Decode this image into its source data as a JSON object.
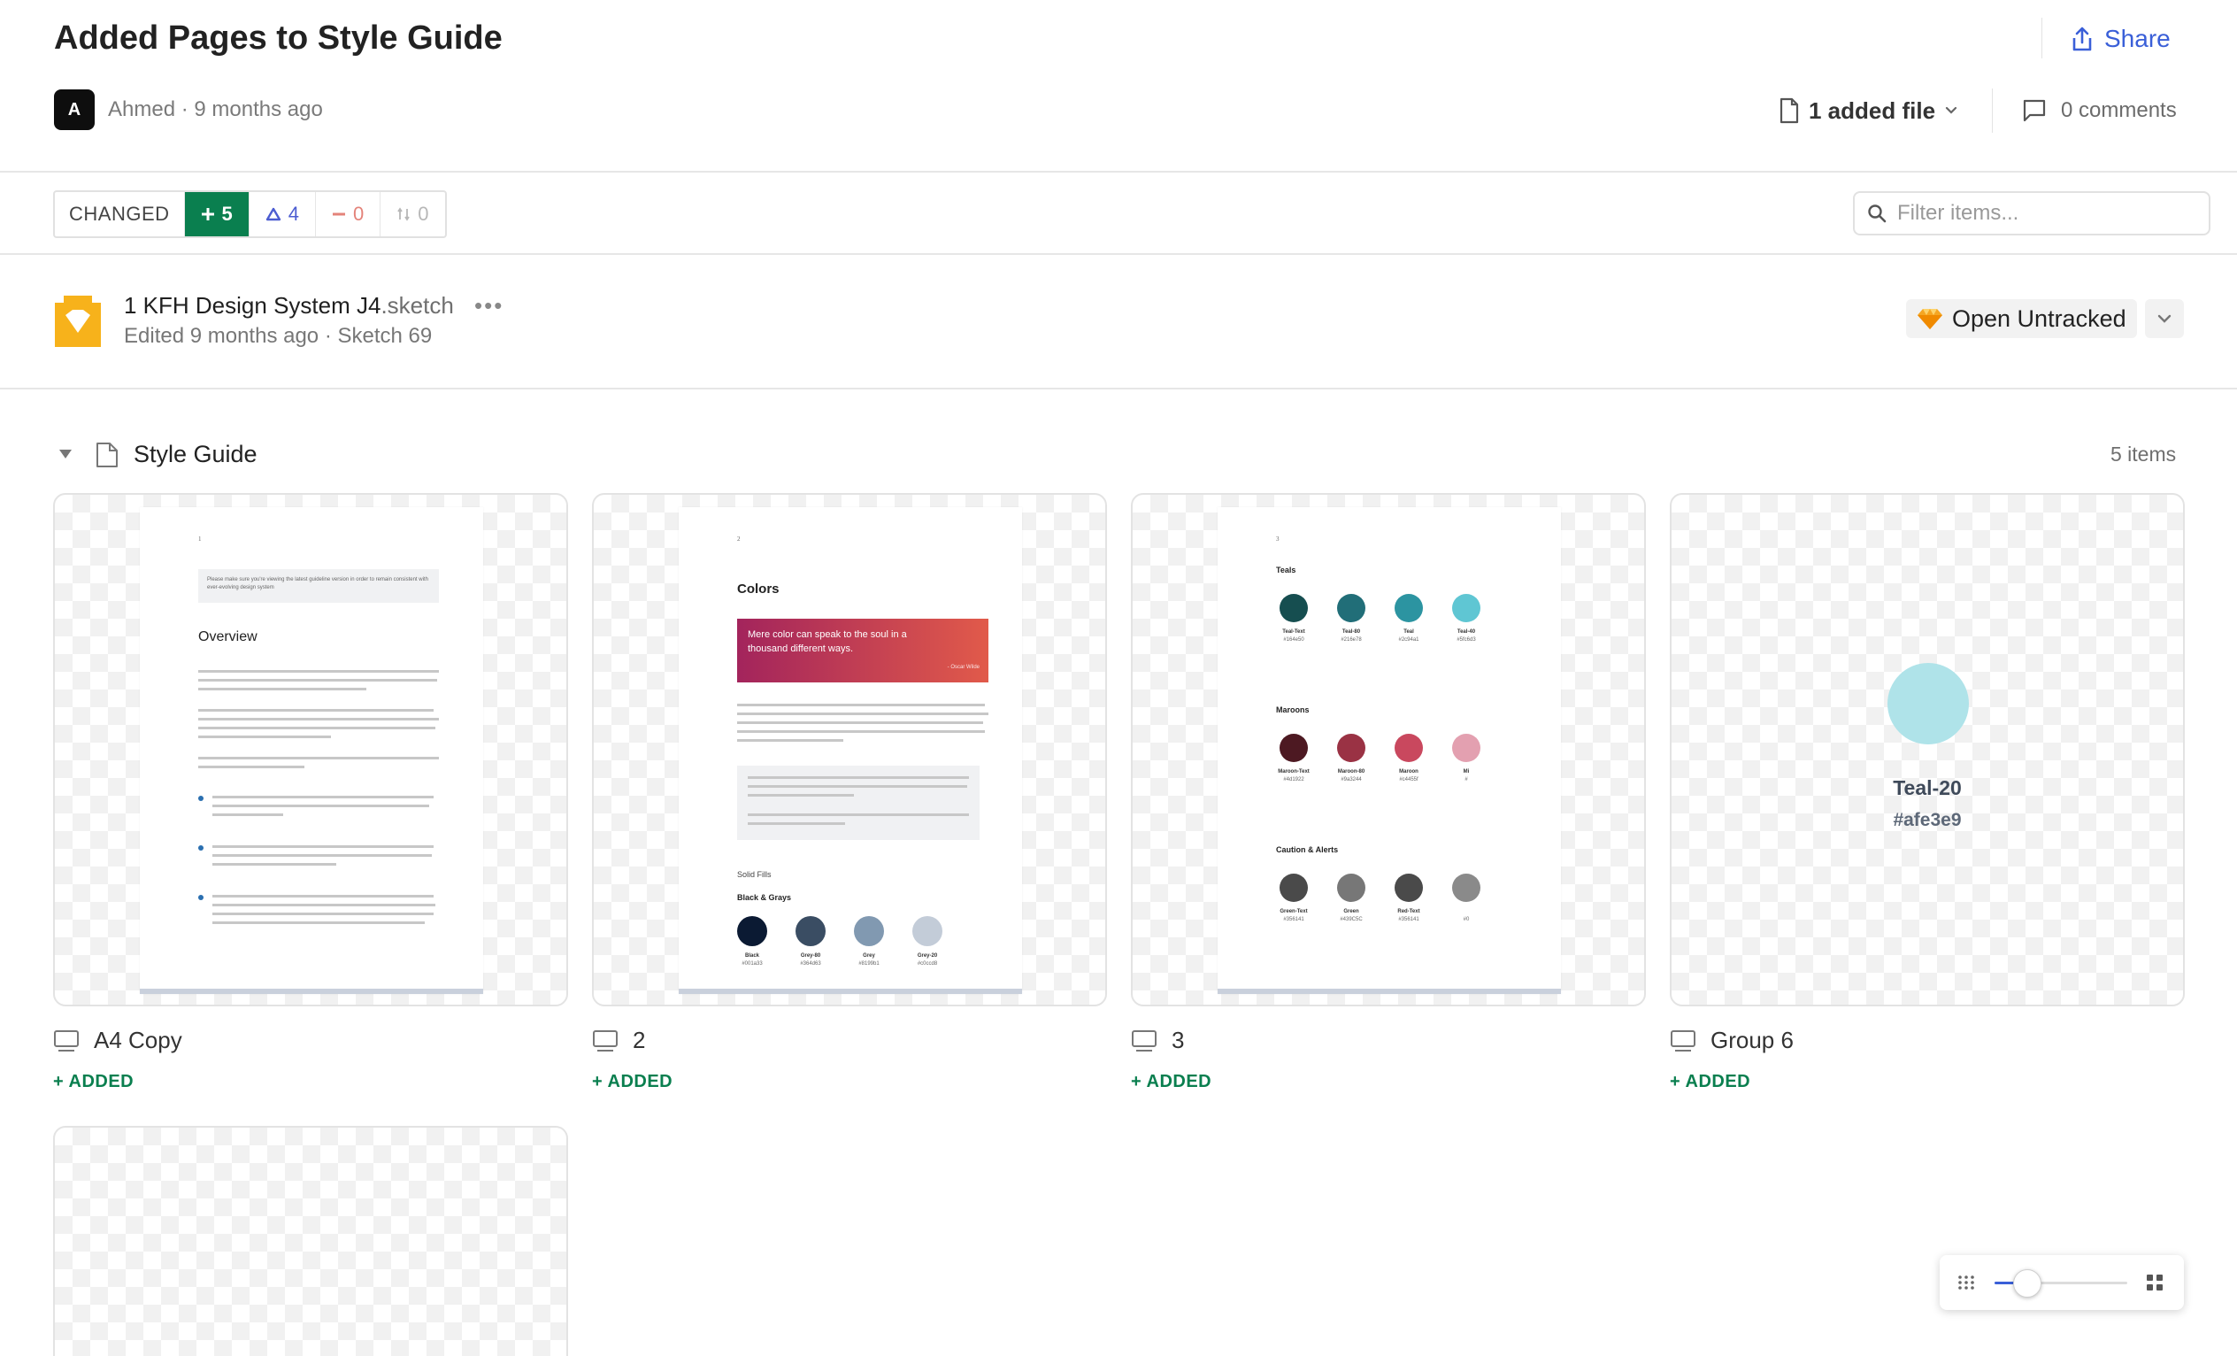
{
  "header": {
    "title": "Added Pages to Style Guide",
    "avatar_initial": "A",
    "author_line": "Ahmed · 9 months ago",
    "share_label": "Share",
    "added_file_label": "1 added file",
    "comments_label": "0 comments"
  },
  "filters": {
    "changed_label": "CHANGED",
    "added_count": "5",
    "modified_count": "4",
    "removed_count": "0",
    "moved_count": "0",
    "search_placeholder": "Filter items..."
  },
  "file": {
    "name": "1 KFH Design System J4",
    "extension": ".sketch",
    "more_label": "•••",
    "subtitle": "Edited 9 months ago · Sketch 69",
    "open_label": "Open Untracked"
  },
  "section": {
    "title": "Style Guide",
    "count": "5 items"
  },
  "cards": [
    {
      "name": "A4 Copy",
      "status": "ADDED"
    },
    {
      "name": "2",
      "status": "ADDED"
    },
    {
      "name": "3",
      "status": "ADDED"
    },
    {
      "name": "Group 6",
      "status": "ADDED"
    }
  ],
  "thumbs": {
    "a4": {
      "page_num": "1",
      "notice": "Please make sure you're viewing the latest guideline version in order to remain consistent with ever-evolving design system",
      "heading": "Overview"
    },
    "colors": {
      "page_num": "2",
      "heading": "Colors",
      "quote": "Mere color can speak to the soul in a thousand different ways.",
      "quote_author": "- Oscar Wilde",
      "solid_fills": "Solid Fills",
      "group_title": "Black & Grays",
      "swatches": [
        {
          "name": "Black",
          "hex": "#001a33",
          "color": "#0b1a33"
        },
        {
          "name": "Grey-80",
          "hex": "#364d63",
          "color": "#3a4d63"
        },
        {
          "name": "Grey",
          "hex": "#8199b1",
          "color": "#8199b1"
        },
        {
          "name": "Grey-20",
          "hex": "#c0ccd8",
          "color": "#c3ccd8"
        }
      ]
    },
    "palette": {
      "page_num": "3",
      "groups": [
        {
          "title": "Teals",
          "swatches": [
            {
              "name": "Teal-Text",
              "hex": "#164e50",
              "color": "#164e50"
            },
            {
              "name": "Teal-80",
              "hex": "#216e78",
              "color": "#216e78"
            },
            {
              "name": "Teal",
              "hex": "#2c94a1",
              "color": "#2c94a1"
            },
            {
              "name": "Teal-40",
              "hex": "#5fc6d3",
              "color": "#5fc6d3"
            }
          ]
        },
        {
          "title": "Maroons",
          "swatches": [
            {
              "name": "Maroon-Text",
              "hex": "#4d1922",
              "color": "#4d1922"
            },
            {
              "name": "Maroon-80",
              "hex": "#9a3244",
              "color": "#9a3244"
            },
            {
              "name": "Maroon",
              "hex": "#c4455f",
              "color": "#c9485e"
            },
            {
              "name": "Mi",
              "hex": "#",
              "color": "#e3a0b0"
            }
          ]
        },
        {
          "title": "Caution & Alerts",
          "swatches": [
            {
              "name": "Green-Text",
              "hex": "#356141",
              "color": "#4a4a4a"
            },
            {
              "name": "Green",
              "hex": "#439C5C",
              "color": "#777777"
            },
            {
              "name": "Red-Text",
              "hex": "#356141",
              "color": "#4a4a4a"
            },
            {
              "name": "",
              "hex": "#0",
              "color": "#8a8a8a"
            }
          ]
        }
      ]
    },
    "group6": {
      "name": "Teal-20",
      "hex": "#afe3e9",
      "color": "#afe3e9"
    }
  },
  "zoom": {
    "level": 0.24
  },
  "colors": {
    "accent": "#3a5fd8",
    "added": "#0a7f4f"
  }
}
